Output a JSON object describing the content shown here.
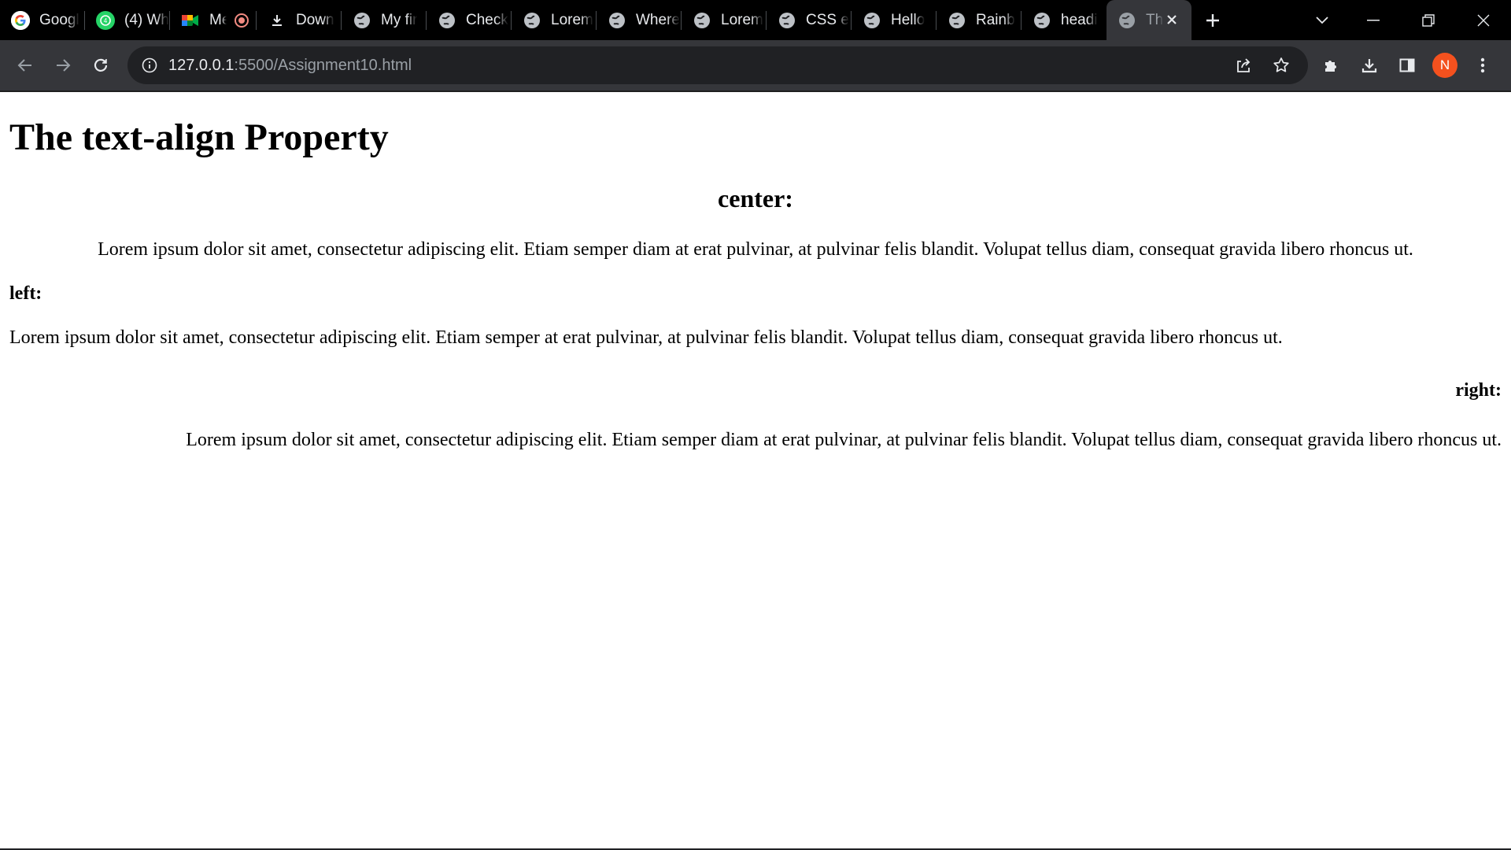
{
  "browser": {
    "tabs": [
      {
        "label": "Googl",
        "icon": "google-icon"
      },
      {
        "label": "(4) Wh",
        "icon": "whatsapp-icon"
      },
      {
        "label": "Me",
        "icon": "google-meet-icon"
      },
      {
        "label": "Down",
        "icon": "download-icon"
      },
      {
        "label": "My fir",
        "icon": "globe-icon"
      },
      {
        "label": "Check",
        "icon": "globe-icon"
      },
      {
        "label": "Lorem",
        "icon": "globe-icon"
      },
      {
        "label": "Where",
        "icon": "globe-icon"
      },
      {
        "label": "Lorem",
        "icon": "globe-icon"
      },
      {
        "label": "CSS e",
        "icon": "globe-icon"
      },
      {
        "label": "Hello",
        "icon": "globe-icon"
      },
      {
        "label": "Rainb",
        "icon": "globe-icon"
      },
      {
        "label": "headi",
        "icon": "globe-icon"
      },
      {
        "label": "Th",
        "icon": "globe-icon",
        "active": true
      }
    ],
    "url_host": "127.0.0.1",
    "url_rest": ":5500/Assignment10.html",
    "avatar_initial": "N",
    "colors": {
      "tabstrip_bg": "#000000",
      "toolbar_bg": "#35363a",
      "omnibox_bg": "#202124",
      "avatar_bg": "#f4511e"
    }
  },
  "page": {
    "title": "The text-align Property",
    "sections": [
      {
        "heading": "center:",
        "align": "center",
        "text": "Lorem ipsum dolor sit amet, consectetur adipiscing elit. Etiam semper diam at erat pulvinar, at pulvinar felis blandit. Volupat tellus diam, consequat gravida libero rhoncus ut."
      },
      {
        "heading": "left:",
        "align": "left",
        "text": "Lorem ipsum dolor sit amet, consectetur adipiscing elit. Etiam semper at erat pulvinar, at pulvinar felis blandit. Volupat tellus diam, consequat gravida libero rhoncus ut."
      },
      {
        "heading": "right:",
        "align": "right",
        "text": "Lorem ipsum dolor sit amet, consectetur adipiscing elit. Etiam semper diam at erat pulvinar, at pulvinar felis blandit. Volupat tellus diam, consequat gravida libero rhoncus ut."
      }
    ]
  }
}
